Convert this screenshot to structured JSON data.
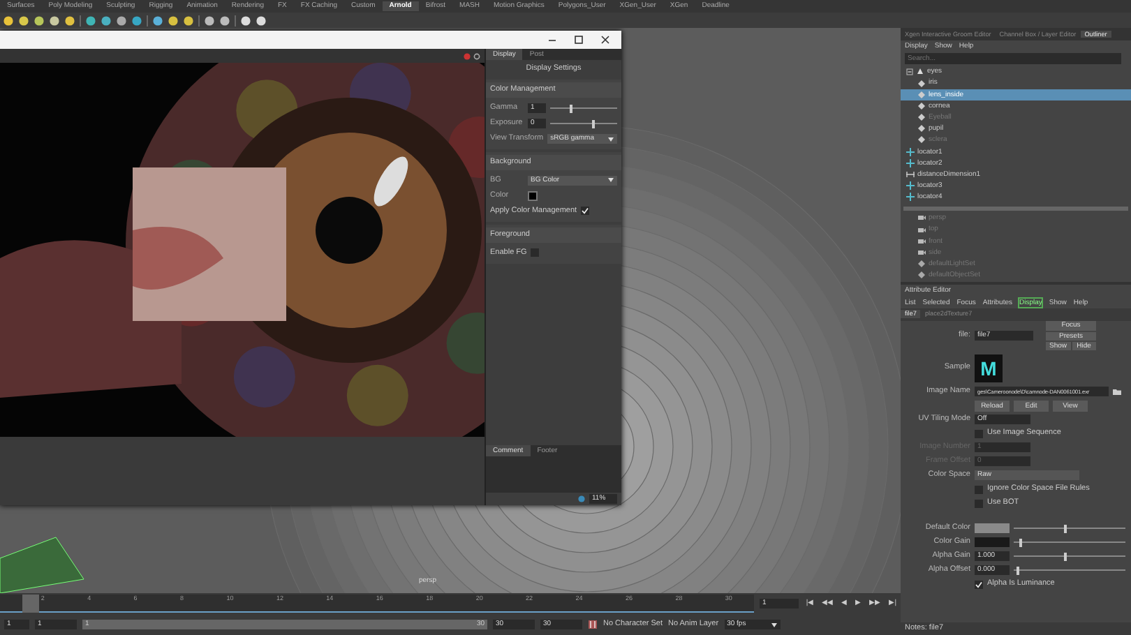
{
  "shelf_tabs": [
    {
      "label": "Surfaces",
      "selected": false
    },
    {
      "label": "Poly Modeling",
      "selected": false
    },
    {
      "label": "Sculpting",
      "selected": false
    },
    {
      "label": "Rigging",
      "selected": false
    },
    {
      "label": "Animation",
      "selected": false
    },
    {
      "label": "Rendering",
      "selected": false
    },
    {
      "label": "FX",
      "selected": false
    },
    {
      "label": "FX Caching",
      "selected": false
    },
    {
      "label": "Custom",
      "selected": false
    },
    {
      "label": "Arnold",
      "selected": true
    },
    {
      "label": "Bifrost",
      "selected": false
    },
    {
      "label": "MASH",
      "selected": false
    },
    {
      "label": "Motion Graphics",
      "selected": false
    },
    {
      "label": "Polygons_User",
      "selected": false
    },
    {
      "label": "XGen_User",
      "selected": false
    },
    {
      "label": "XGen",
      "selected": false
    },
    {
      "label": "Deadline",
      "selected": false
    }
  ],
  "render_view": {
    "display_panel": {
      "tabs": [
        {
          "label": "Display",
          "selected": true
        },
        {
          "label": "Post",
          "selected": false
        }
      ],
      "heading": "Display Settings",
      "sections": [
        {
          "title": "Color Management",
          "rows": [
            {
              "kind": "slider",
              "label": "Gamma",
              "value": "1",
              "level": 0.3
            },
            {
              "kind": "slider",
              "label": "Exposure",
              "value": "0",
              "level": 0.62
            },
            {
              "kind": "dropdown",
              "label": "View Transform",
              "value": "sRGB gamma"
            }
          ]
        },
        {
          "title": "Background",
          "rows": [
            {
              "kind": "dropdown",
              "label": "BG",
              "value": "BG Color"
            },
            {
              "kind": "swatch",
              "label": "Color",
              "color": "#000000"
            },
            {
              "kind": "check",
              "label": "Apply Color Management",
              "checked": true
            }
          ]
        },
        {
          "title": "Foreground",
          "rows": [
            {
              "kind": "check",
              "label": "Enable FG",
              "checked": false
            }
          ]
        }
      ]
    },
    "bottom_tabs": [
      {
        "label": "Comment",
        "selected": true
      },
      {
        "label": "Footer",
        "selected": false
      }
    ],
    "zoom": "11%"
  },
  "viewport": {
    "camera": "persp"
  },
  "outliner": {
    "tabs": [
      {
        "label": "Xgen Interactive Groom Editor",
        "selected": false
      },
      {
        "label": "Channel Box / Layer Editor",
        "selected": false
      },
      {
        "label": "Outliner",
        "selected": true
      }
    ],
    "menu": [
      "Display",
      "Show",
      "Help"
    ],
    "search": {
      "placeholder": "Search..."
    },
    "items": [
      {
        "label": "eyes",
        "kind": "group",
        "selected": false,
        "dim": false,
        "children": [
          {
            "label": "iris",
            "kind": "mesh",
            "selected": false,
            "dim": false
          },
          {
            "label": "lens_inside",
            "kind": "mesh",
            "selected": true,
            "dim": false
          },
          {
            "label": "cornea",
            "kind": "mesh",
            "selected": false,
            "dim": false
          },
          {
            "label": "Eyeball",
            "kind": "mesh",
            "selected": false,
            "dim": true
          },
          {
            "label": "pupil",
            "kind": "mesh",
            "selected": false,
            "dim": false
          },
          {
            "label": "sclera",
            "kind": "mesh",
            "selected": false,
            "dim": true
          }
        ]
      },
      {
        "label": "locator1",
        "kind": "locator",
        "selected": false,
        "dim": false
      },
      {
        "label": "locator2",
        "kind": "locator",
        "selected": false,
        "dim": false
      },
      {
        "label": "distanceDimension1",
        "kind": "measure",
        "selected": false,
        "dim": false
      },
      {
        "label": "locator3",
        "kind": "locator",
        "selected": false,
        "dim": false
      },
      {
        "label": "locator4",
        "kind": "locator",
        "selected": false,
        "dim": false
      }
    ],
    "defaults": [
      {
        "label": "persp",
        "kind": "camera"
      },
      {
        "label": "top",
        "kind": "camera"
      },
      {
        "label": "front",
        "kind": "camera"
      },
      {
        "label": "side",
        "kind": "camera"
      },
      {
        "label": "defaultLightSet",
        "kind": "set"
      },
      {
        "label": "defaultObjectSet",
        "kind": "set"
      }
    ]
  },
  "attribute_editor": {
    "title": "Attribute Editor",
    "menu": [
      {
        "label": "List",
        "selected": false
      },
      {
        "label": "Selected",
        "selected": false
      },
      {
        "label": "Focus",
        "selected": false
      },
      {
        "label": "Attributes",
        "selected": false
      },
      {
        "label": "Display",
        "selected": true
      },
      {
        "label": "Show",
        "selected": false
      },
      {
        "label": "Help",
        "selected": false
      }
    ],
    "node_tabs": [
      {
        "label": "file7",
        "selected": true
      },
      {
        "label": "place2dTexture7",
        "selected": false
      }
    ],
    "node_label": "file:",
    "node_value": "file7",
    "side_buttons": [
      "Focus",
      "Presets",
      "Show",
      "Hide"
    ],
    "rows": [
      {
        "kind": "sample",
        "label": "Sample",
        "value": "M"
      },
      {
        "kind": "path",
        "label": "Image Name",
        "value": "ges\\Cameroonode\\D\\camnode-DAN0061001.exr"
      },
      {
        "kind": "buttons",
        "items": [
          "Reload",
          "Edit",
          "View"
        ]
      },
      {
        "kind": "field",
        "label": "UV Tiling Mode",
        "value": "Off",
        "disabled": false
      },
      {
        "kind": "check",
        "label": "Use Image Sequence",
        "checked": false
      },
      {
        "kind": "field",
        "label": "Image Number",
        "value": "1",
        "disabled": true
      },
      {
        "kind": "field",
        "label": "Frame Offset",
        "value": "0",
        "disabled": true
      },
      {
        "kind": "dropdown",
        "label": "Color Space",
        "value": "Raw"
      },
      {
        "kind": "check",
        "label": "Ignore Color Space File Rules",
        "checked": false
      },
      {
        "kind": "check",
        "label": "Use BOT",
        "checked": false
      },
      {
        "kind": "gap"
      },
      {
        "kind": "swatch",
        "label": "Default Color",
        "color": "#8a8a8a",
        "level": 0.45
      },
      {
        "kind": "swatch",
        "label": "Color Gain",
        "color": "#1a1a1a",
        "level": 0.05
      },
      {
        "kind": "slider",
        "label": "Alpha Gain",
        "value": "1.000",
        "level": 0.45
      },
      {
        "kind": "slider",
        "label": "Alpha Offset",
        "value": "0.000",
        "level": 0.02
      },
      {
        "kind": "check",
        "label": "Alpha Is Luminance",
        "checked": true
      }
    ],
    "notes": "Notes:  file7"
  },
  "timeline": {
    "ticks": [
      "2",
      "4",
      "6",
      "8",
      "10",
      "12",
      "14",
      "16",
      "18",
      "20",
      "22",
      "24",
      "26",
      "28",
      "30"
    ],
    "level": 0.03,
    "current_frame": "1",
    "playback": [
      "|◀",
      "◀◀",
      "◀",
      "▶",
      "▶▶",
      "▶|"
    ]
  },
  "range": {
    "start": "1",
    "range_start": "1",
    "slider_start": "1",
    "slider_end": "30",
    "level": 1,
    "end": "30",
    "end2": "30",
    "character_set": "No Character Set",
    "anim_layer": "No Anim Layer",
    "fps": "30 fps"
  }
}
